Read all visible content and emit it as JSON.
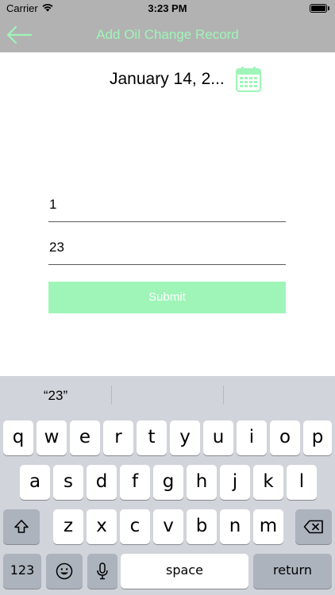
{
  "status_bar": {
    "carrier": "Carrier",
    "time": "3:23 PM"
  },
  "nav": {
    "title": "Add Oil Change Record",
    "back_icon": "arrow-left-icon"
  },
  "form": {
    "date": "January 14, 2...",
    "calendar_icon": "calendar-icon",
    "field1_value": "1",
    "field2_value": "23",
    "submit_label": "Submit"
  },
  "keyboard": {
    "prediction": "“23”",
    "row1": [
      "q",
      "w",
      "e",
      "r",
      "t",
      "y",
      "u",
      "i",
      "o",
      "p"
    ],
    "row2": [
      "a",
      "s",
      "d",
      "f",
      "g",
      "h",
      "j",
      "k",
      "l"
    ],
    "row3": [
      "z",
      "x",
      "c",
      "v",
      "b",
      "n",
      "m"
    ],
    "numbers_label": "123",
    "space_label": "space",
    "return_label": "return"
  },
  "colors": {
    "accent": "#9ff5b8",
    "nav_bg": "#b2b2b2",
    "keyboard_bg": "#d1d4da"
  }
}
